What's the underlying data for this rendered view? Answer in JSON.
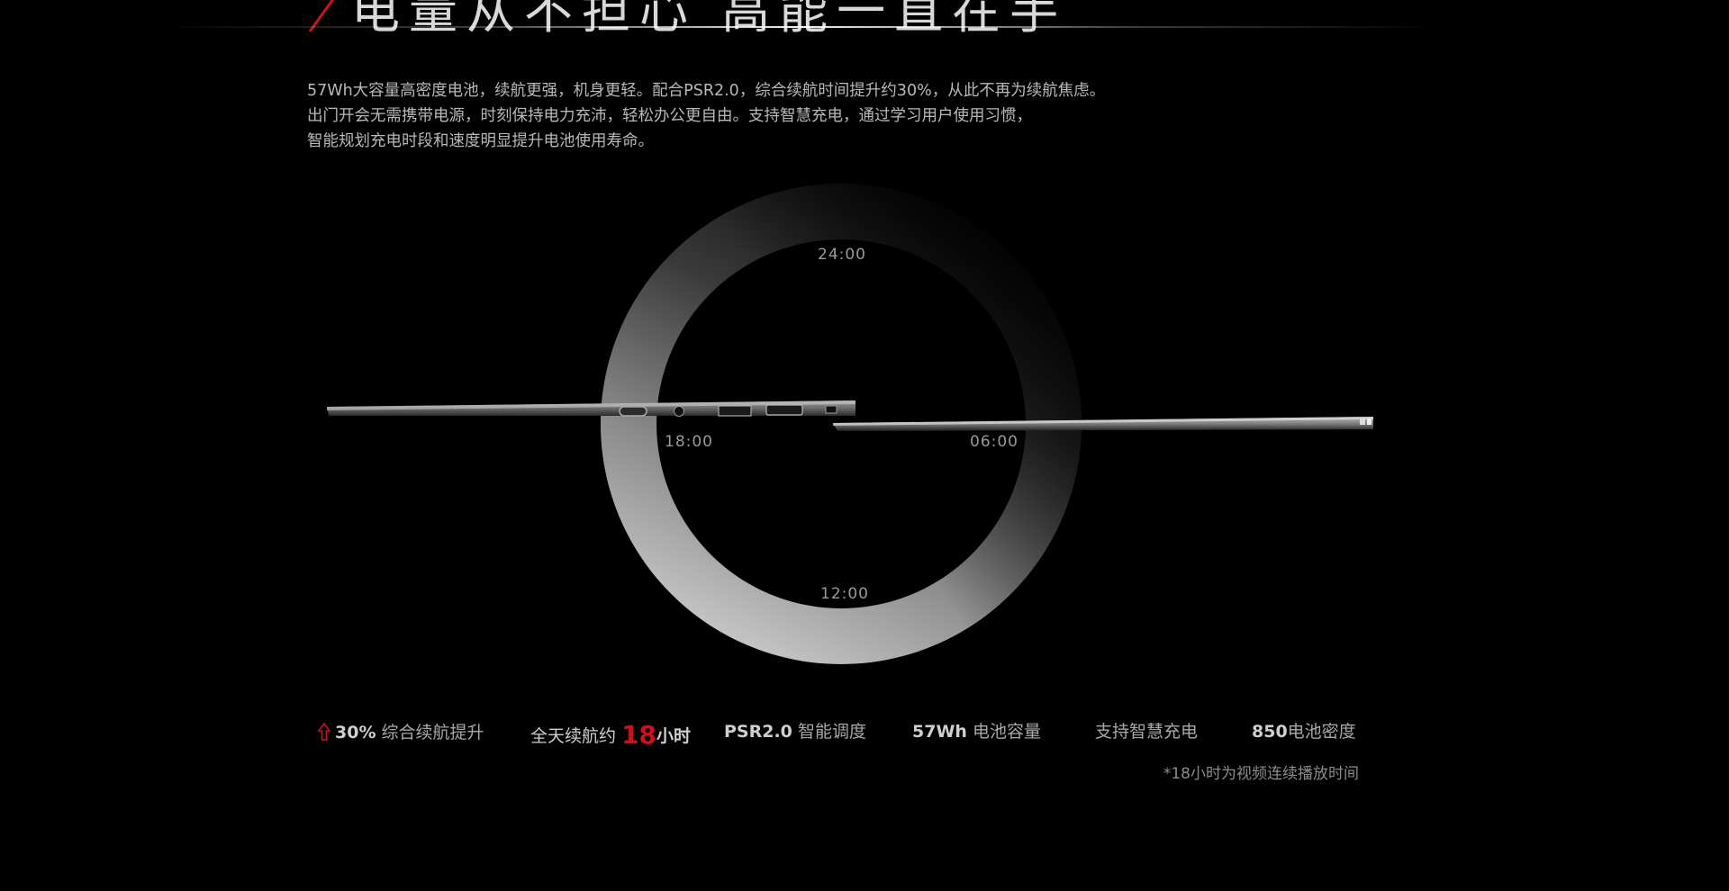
{
  "headline": "电量从不担心 高能一直在手",
  "description": [
    "57Wh大容量高密度电池，续航更强，机身更轻。配合PSR2.0，综合续航时间提升约30%，从此不再为续航焦虑。",
    "出门开会无需携带电源，时刻保持电力充沛，轻松办公更自由。支持智慧充电，通过学习用户使用习惯，",
    "智能规划充电时段和速度明显提升电池使用寿命。"
  ],
  "dial": {
    "top": "24:00",
    "right": "06:00",
    "bottom": "12:00",
    "left": "18:00"
  },
  "stats": {
    "s1_value": "30%",
    "s1_label": "综合续航提升",
    "s2_prefix": "全天续航约",
    "s2_value": "18",
    "s2_unit": "小时",
    "s3_value": "PSR2.0",
    "s3_label": "智能调度",
    "s4_value": "57Wh",
    "s4_label": "电池容量",
    "s5_label": "支持智慧充电",
    "s6_value": "850",
    "s6_label": "电池密度"
  },
  "note": "*18小时为视频连续播放时间",
  "colors": {
    "background": "#000000",
    "accent_red": "#c7141c",
    "text": "#b9b9b9"
  }
}
